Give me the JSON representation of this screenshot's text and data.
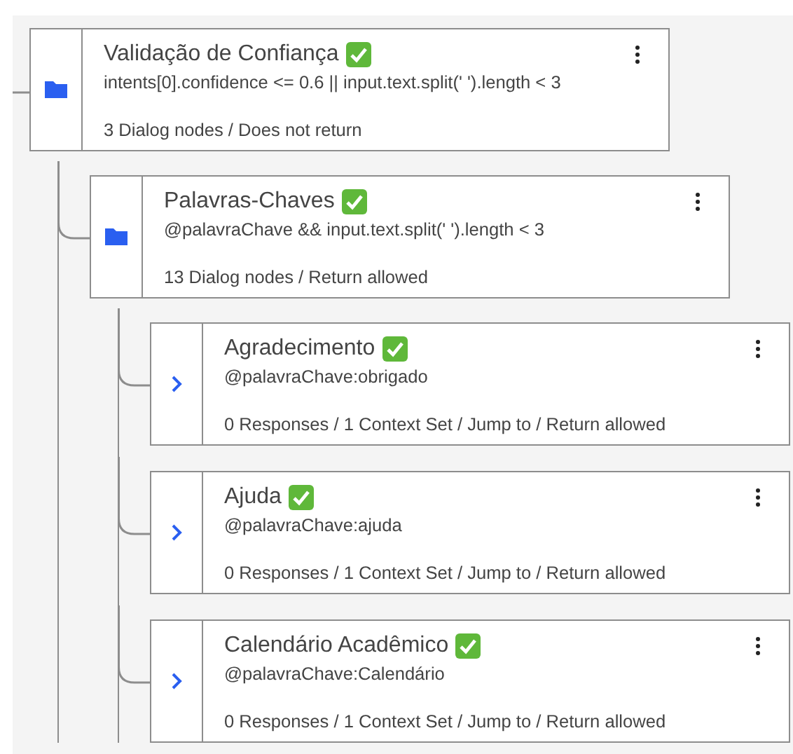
{
  "nodes": [
    {
      "kind": "folder",
      "title": "Validação de Confiança",
      "verified": true,
      "condition": "intents[0].confidence <= 0.6 || input.text.split(' ').length < 3",
      "summary": "3 Dialog nodes / Does not return",
      "children": [
        {
          "kind": "folder",
          "title": "Palavras-Chaves",
          "verified": true,
          "condition": "@palavraChave && input.text.split(' ').length < 3",
          "summary": "13 Dialog nodes / Return allowed",
          "children": [
            {
              "kind": "node",
              "title": "Agradecimento",
              "verified": true,
              "condition": "@palavraChave:obrigado",
              "summary": "0 Responses / 1 Context Set / Jump to / Return allowed"
            },
            {
              "kind": "node",
              "title": "Ajuda",
              "verified": true,
              "condition": "@palavraChave:ajuda",
              "summary": "0 Responses / 1 Context Set / Jump to / Return allowed"
            },
            {
              "kind": "node",
              "title": "Calendário Acadêmico",
              "verified": true,
              "condition": "@palavraChave:Calendário",
              "summary": "0 Responses / 1 Context Set / Jump to / Return allowed"
            }
          ]
        }
      ]
    }
  ]
}
